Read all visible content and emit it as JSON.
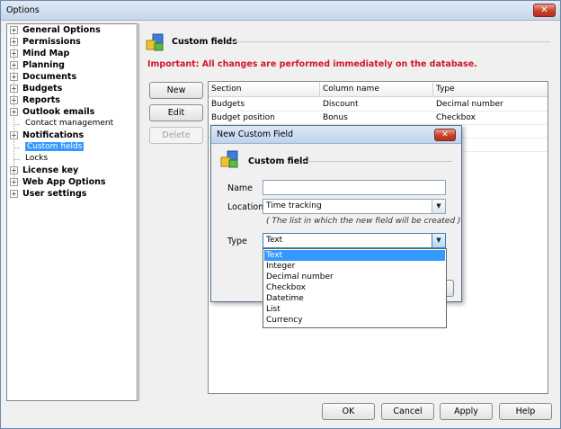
{
  "window": {
    "title": "Options",
    "close_glyph": "✕"
  },
  "tree": {
    "items": [
      {
        "label": "General Options",
        "expander": "+"
      },
      {
        "label": "Permissions",
        "expander": "+"
      },
      {
        "label": "Mind Map",
        "expander": "+"
      },
      {
        "label": "Planning",
        "expander": "+"
      },
      {
        "label": "Documents",
        "expander": "+"
      },
      {
        "label": "Budgets",
        "expander": "+"
      },
      {
        "label": "Reports",
        "expander": "+"
      },
      {
        "label": "Outlook emails",
        "expander": "+"
      },
      {
        "label": "Contact management",
        "child": true
      },
      {
        "label": "Notifications",
        "expander": "+"
      },
      {
        "label": "Custom fields",
        "child": true,
        "selected": true
      },
      {
        "label": "Locks",
        "child": true
      },
      {
        "label": "License key",
        "expander": "+"
      },
      {
        "label": "Web App Options",
        "expander": "+"
      },
      {
        "label": "User settings",
        "expander": "+"
      }
    ]
  },
  "main": {
    "section_title": "Custom fields",
    "warning": "Important: All changes are performed immediately on the database.",
    "buttons": {
      "new": "New",
      "edit": "Edit",
      "delete": "Delete"
    },
    "grid": {
      "columns": [
        "Section",
        "Column name",
        "Type"
      ],
      "rows": [
        [
          "Budgets",
          "Discount",
          "Decimal number"
        ],
        [
          "Budget position",
          "Bonus",
          "Checkbox"
        ]
      ]
    }
  },
  "dialog": {
    "title": "New Custom Field",
    "close_glyph": "✕",
    "section_title": "Custom field",
    "name_label": "Name",
    "name_value": "",
    "location_label": "Location",
    "location_value": "Time tracking",
    "location_hint": "( The list in which the new field will be created )",
    "type_label": "Type",
    "type_value": "Text",
    "type_options": [
      "Text",
      "Integer",
      "Decimal number",
      "Checkbox",
      "Datetime",
      "List",
      "Currency"
    ],
    "type_selected": "Text"
  },
  "footer": {
    "ok": "OK",
    "cancel": "Cancel",
    "apply": "Apply",
    "help": "Help"
  },
  "colors": {
    "warning": "#d2142c",
    "selection": "#3399ff"
  }
}
